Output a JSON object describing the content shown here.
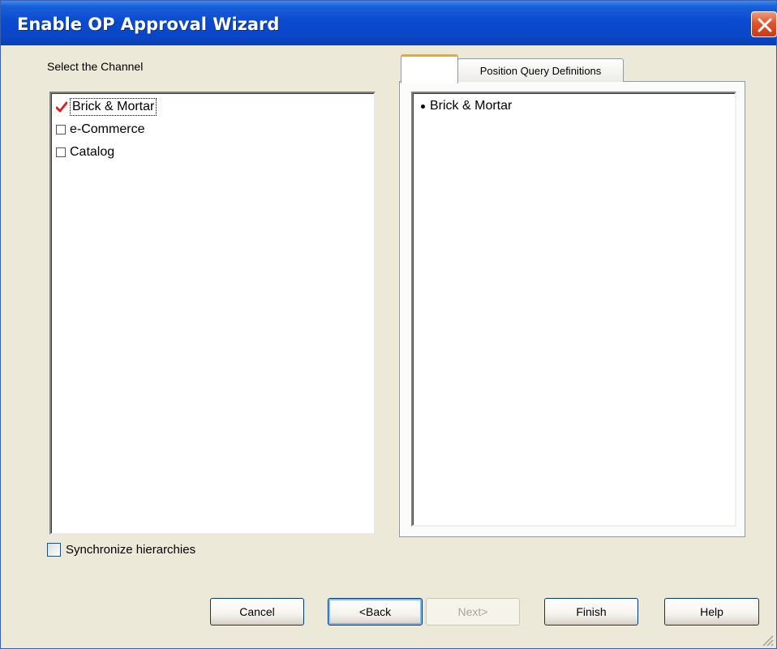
{
  "window": {
    "title": "Enable OP Approval Wizard"
  },
  "channel_panel": {
    "label": "Select the Channel",
    "items": [
      {
        "label": "Brick & Mortar",
        "checked": true
      },
      {
        "label": "e-Commerce",
        "checked": false
      },
      {
        "label": "Catalog",
        "checked": false
      }
    ]
  },
  "sync": {
    "label": "Synchronize hierarchies",
    "checked": false
  },
  "tabs": {
    "first_label": "",
    "second_label": "Position Query Definitions",
    "items": [
      {
        "label": "Brick & Mortar"
      }
    ]
  },
  "buttons": {
    "cancel": "Cancel",
    "back": "<Back",
    "next": "Next>",
    "finish": "Finish",
    "help": "Help"
  },
  "colors": {
    "title_bar": "#0b4bd0",
    "close_button": "#e0542c",
    "checkmark": "#e02020",
    "tab_highlight": "#f5a623"
  }
}
